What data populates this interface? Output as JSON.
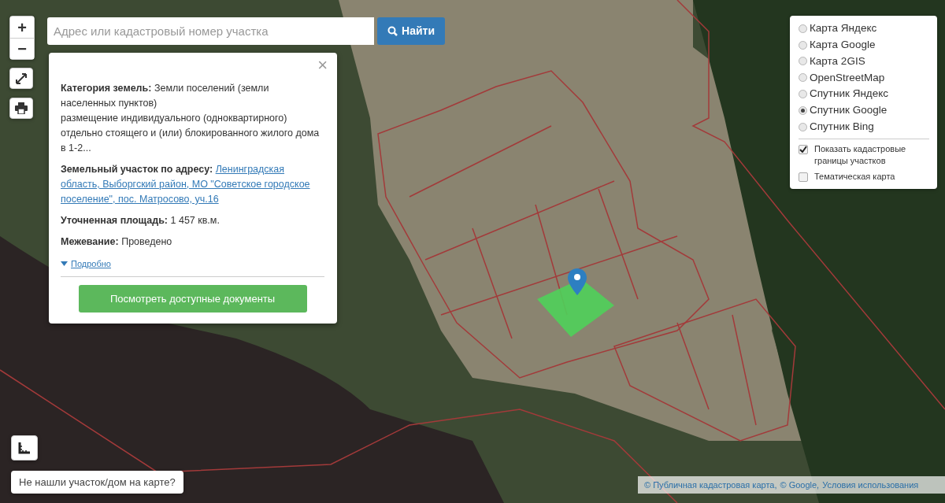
{
  "zoom_controls": [
    "+",
    "−"
  ],
  "search": {
    "placeholder": "Адрес или кадастровый номер участка",
    "button": "Найти"
  },
  "popup": {
    "close": "×",
    "category": [
      "**Категория земель:** Земли поселений (земли населенных пунктов)",
      "размещение индивидуального (одноквартирного) отдельно стоящего и (или) блокированного жилого дома в 1-2..."
    ],
    "address_label": "Земельный участок по адресу:",
    "address_link": "Ленинградская область, Выборгский район, МО \"Советское городское поселение\", пос. Матросово, уч.16",
    "facts": [
      "**Уточненная площадь:** 1 457 кв.м.",
      "**Межевание:** Проведено"
    ],
    "more_link": "Подробно",
    "documents_button": "Посмотреть доступные документы"
  },
  "layers": {
    "base_maps": [
      {
        "label": "Карта Яндекс",
        "selected": false
      },
      {
        "label": "Карта Google",
        "selected": false
      },
      {
        "label": "Карта 2GIS",
        "selected": false
      },
      {
        "label": "OpenStreetMap",
        "selected": false
      },
      {
        "label": "Спутник Яндекс",
        "selected": false
      },
      {
        "label": "Спутник Google",
        "selected": true
      },
      {
        "label": "Спутник Bing",
        "selected": false
      }
    ],
    "overlays": [
      {
        "label": "Показать кадастровые границы участков",
        "checked": true
      },
      {
        "label": "Тематическая карта",
        "checked": false
      }
    ]
  },
  "not_found_button": "Не нашли участок/дом на карте?",
  "attribution": [
    "© Публичная кадастровая карта,",
    "© Google,",
    "Условия использования"
  ]
}
